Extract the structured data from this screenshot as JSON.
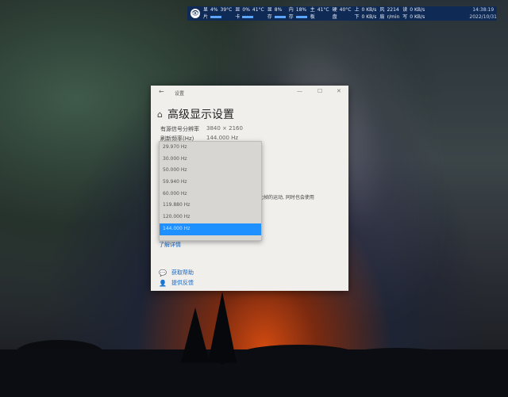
{
  "monitor": {
    "cpu_label_top": "显",
    "cpu_label_bottom": "片",
    "cpu_pct": "4%",
    "cpu_temp": "39°C",
    "gpu_label_top": "显",
    "gpu_label_bottom": "卡",
    "gpu_pct": "0%",
    "gpu_temp": "41°C",
    "ram_label_top": "显",
    "ram_label_bottom": "存",
    "ram_pct": "8%",
    "mem_label_top": "内",
    "mem_label_bottom": "存",
    "mem_pct": "18%",
    "board_label_top": "主",
    "board_label_bottom": "板",
    "board_temp": "41°C",
    "disk_label_top": "硬",
    "disk_label_bottom": "盘",
    "disk_temp": "40°C",
    "net_label_top": "上",
    "net_label_bottom": "下",
    "net_up": "0 KB/s",
    "net_down": "0 KB/s",
    "fan_label_top": "风",
    "fan_label_bottom": "扇",
    "fan_value": "2214",
    "fan_unit": "r/min",
    "io_label_top": "读",
    "io_label_bottom": "写",
    "io_read": "0 KB/s",
    "io_write": "0 KB/s"
  },
  "clock": {
    "time": "14:38:19",
    "date": "2022/10/31"
  },
  "window": {
    "title": "设置",
    "minimize": "—",
    "maximize": "☐",
    "close": "✕",
    "heading": "高级显示设置",
    "resolution_label": "有源信号分辨率",
    "resolution_value": "3840 × 2160",
    "refresh_label": "刷新频率(Hz)",
    "refresh_value": "144.000 Hz",
    "hint_text": "此帧的运动, 同时也会使用",
    "learn_more": "了解详情",
    "get_help": "获取帮助",
    "feedback": "提供反馈"
  },
  "dropdown": {
    "options": [
      "29.970 Hz",
      "30.000 Hz",
      "50.000 Hz",
      "59.940 Hz",
      "60.000 Hz",
      "119.880 Hz",
      "120.000 Hz",
      "144.000 Hz"
    ],
    "selected": "144.000 Hz"
  }
}
